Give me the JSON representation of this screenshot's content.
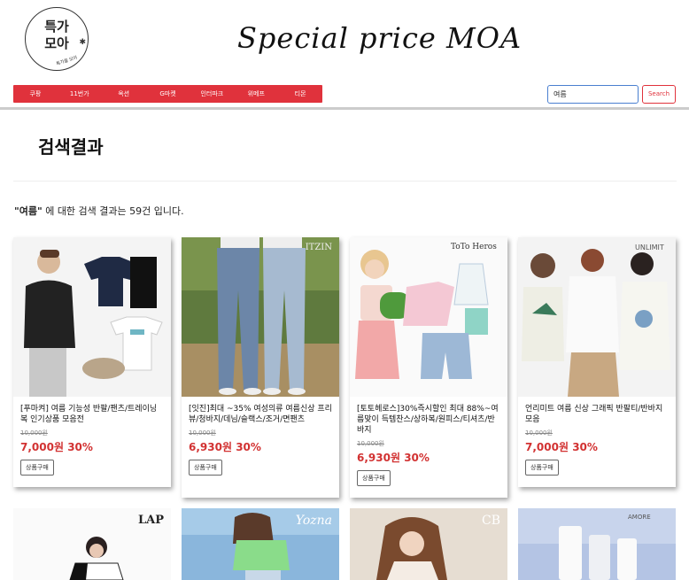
{
  "logo": {
    "line1": "특가",
    "line2": "모아",
    "sub": "특가를 모아",
    "star": "✱"
  },
  "brand_title": "Special price MOA",
  "nav": {
    "items": [
      "쿠팡",
      "11번가",
      "옥션",
      "G마켓",
      "인터파크",
      "위메프",
      "티몬"
    ]
  },
  "search": {
    "value": "여름",
    "button_label": "Search"
  },
  "page_title": "검색결과",
  "result": {
    "keyword": "\"여름\"",
    "text": " 에 대한 검색 결과는 59건 입니다."
  },
  "products": [
    {
      "title": "[푸마켜] 여름 기능성 반팔/팬츠/트레이닝복 인기상품 모음전",
      "orig_price": "10,000원",
      "price": "7,000원",
      "discount": "30%",
      "button": "상품구매",
      "brand": ""
    },
    {
      "title": "[잇진]최대 ~35% 여성의류 여름신상 프리뷰/청바지/데님/슬랙스/조거/면팬츠",
      "orig_price": "10,000원",
      "price": "6,930원",
      "discount": "30%",
      "button": "상품구매",
      "brand": "ITZIN"
    },
    {
      "title": "[토토헤로스]30%즉시할인 최대 88%~여름맞이 득템찬스/상하복/원피스/티셔츠/반바지",
      "orig_price": "10,000원",
      "price": "6,930원",
      "discount": "30%",
      "button": "상품구매",
      "brand": "ToTo Heros"
    },
    {
      "title": "언리미트 여름 신상 그래픽 반팔티/반바지 모음",
      "orig_price": "10,000원",
      "price": "7,000원",
      "discount": "30%",
      "button": "상품구매",
      "brand": "UNLIMIT"
    }
  ],
  "products_row2": [
    {
      "brand": "LAP"
    },
    {
      "brand": "Yozna"
    },
    {
      "brand": "CB"
    },
    {
      "brand": "AMORE"
    }
  ],
  "colors": {
    "accent": "#e0323c",
    "price": "#d23232",
    "search_border": "#4a7fd0"
  }
}
